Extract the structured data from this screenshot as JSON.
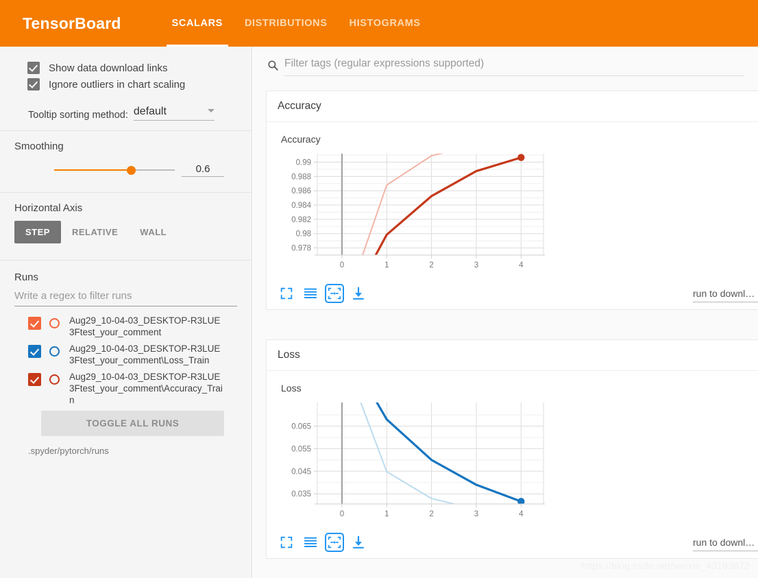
{
  "app": {
    "brand": "TensorBoard",
    "tabs": [
      {
        "label": "SCALARS",
        "active": true
      },
      {
        "label": "DISTRIBUTIONS",
        "active": false
      },
      {
        "label": "HISTOGRAMS",
        "active": false
      }
    ],
    "watermark": "https://blog.csdn.net/weixin_43183872",
    "accent_color": "#f57c00"
  },
  "sidebar": {
    "checkboxes": [
      {
        "label": "Show data download links",
        "checked": true
      },
      {
        "label": "Ignore outliers in chart scaling",
        "checked": true
      }
    ],
    "tooltip_sorting": {
      "label": "Tooltip sorting method:",
      "value": "default",
      "icon": "chevron-down-icon"
    },
    "smoothing": {
      "title": "Smoothing",
      "value": "0.6"
    },
    "horizontal_axis": {
      "title": "Horizontal Axis",
      "options": [
        {
          "label": "STEP",
          "active": true
        },
        {
          "label": "RELATIVE",
          "active": false
        },
        {
          "label": "WALL",
          "active": false
        }
      ]
    },
    "runs": {
      "title": "Runs",
      "filter_placeholder": "Write a regex to filter runs",
      "filter_value": "",
      "items": [
        {
          "label": "Aug29_10-04-03_DESKTOP-R3LUE3Ftest_your_comment",
          "color": "#f4663c",
          "checked": true
        },
        {
          "label": "Aug29_10-04-03_DESKTOP-R3LUE3Ftest_your_comment\\Loss_Train",
          "color": "#1775bf",
          "checked": true
        },
        {
          "label": "Aug29_10-04-03_DESKTOP-R3LUE3Ftest_your_comment\\Accuracy_Train",
          "color": "#c5391a",
          "checked": true
        }
      ],
      "toggle_all_label": "TOGGLE ALL RUNS",
      "logdir": ".spyder/pytorch/runs"
    }
  },
  "main": {
    "filter": {
      "icon": "search-icon",
      "placeholder": "Filter tags (regular expressions supported)",
      "value": ""
    },
    "cards": [
      {
        "header": "Accuracy",
        "tools": [
          {
            "name": "expand-chart-icon",
            "active": false
          },
          {
            "name": "data-table-icon",
            "active": false
          },
          {
            "name": "fit-domain-icon",
            "active": true
          },
          {
            "name": "download-icon",
            "active": false
          }
        ],
        "download_select": {
          "label": "run to downl…",
          "icon": "chevron-down-icon"
        }
      },
      {
        "header": "Loss",
        "tools": [
          {
            "name": "expand-chart-icon",
            "active": false
          },
          {
            "name": "data-table-icon",
            "active": false
          },
          {
            "name": "fit-domain-icon",
            "active": true
          },
          {
            "name": "download-icon",
            "active": false
          }
        ],
        "download_select": {
          "label": "run to downl…",
          "icon": "chevron-down-icon"
        }
      }
    ]
  },
  "chart_data": [
    {
      "type": "line",
      "title": "Accuracy",
      "xlabel": "",
      "ylabel": "",
      "xlim": [
        -0.55,
        4.5
      ],
      "ylim": [
        0.977,
        0.9912
      ],
      "xticks": [
        0,
        1,
        2,
        3,
        4
      ],
      "yticks": [
        0.978,
        0.98,
        0.982,
        0.984,
        0.986,
        0.988,
        0.99
      ],
      "grid": true,
      "legend": "none",
      "series": [
        {
          "name": "Aug29_10-04-03_DESKTOP-R3LUE3Ftest_your_comment\\Accuracy_Train (raw)",
          "color": "#f2b5a6",
          "width": 2,
          "x": [
            0.45,
            1,
            2,
            3
          ],
          "y": [
            0.9768,
            0.9868,
            0.9909,
            0.9924
          ]
        },
        {
          "name": "Aug29_10-04-03_DESKTOP-R3LUE3Ftest_your_comment\\Accuracy_Train (smoothed)",
          "color": "#c5391a",
          "width": 3.2,
          "marker_last": true,
          "x": [
            0.75,
            1,
            2,
            3,
            4
          ],
          "y": [
            0.97695,
            0.97985,
            0.98525,
            0.98875,
            0.99065
          ]
        }
      ]
    },
    {
      "type": "line",
      "title": "Loss",
      "xlabel": "",
      "ylabel": "",
      "xlim": [
        -0.55,
        4.5
      ],
      "ylim": [
        0.0305,
        0.0755
      ],
      "xticks": [
        0,
        1,
        2,
        3,
        4
      ],
      "yticks": [
        0.035,
        0.045,
        0.055,
        0.065
      ],
      "grid": true,
      "legend": "none",
      "series": [
        {
          "name": "Aug29_10-04-03_DESKTOP-R3LUE3Ftest_your_comment\\Loss_Train (raw)",
          "color": "#bcdcef",
          "width": 2,
          "x": [
            0.42,
            1,
            2,
            2.5
          ],
          "y": [
            0.0755,
            0.0448,
            0.0329,
            0.0305
          ]
        },
        {
          "name": "Aug29_10-04-03_DESKTOP-R3LUE3Ftest_your_comment\\Loss_Train (smoothed)",
          "color": "#1775bf",
          "width": 3.2,
          "marker_last": true,
          "x": [
            0.78,
            1,
            2,
            3,
            4
          ],
          "y": [
            0.0755,
            0.068,
            0.05,
            0.039,
            0.0316
          ]
        }
      ]
    }
  ]
}
